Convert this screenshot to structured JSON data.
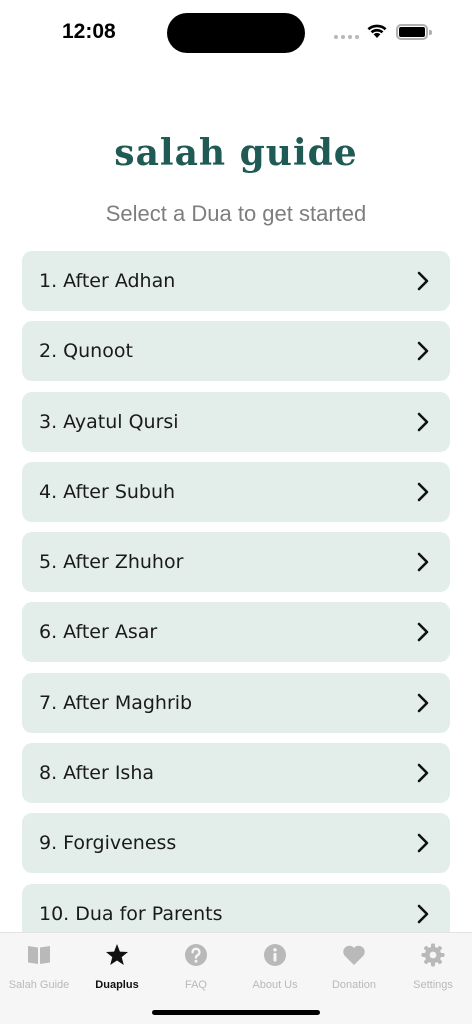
{
  "status_bar": {
    "time": "12:08"
  },
  "header": {
    "logo_text": "salah guide",
    "subtitle": "Select a Dua to get started"
  },
  "duas": [
    {
      "label": "1. After Adhan"
    },
    {
      "label": "2. Qunoot"
    },
    {
      "label": "3. Ayatul Qursi"
    },
    {
      "label": "4. After Subuh"
    },
    {
      "label": "5. After Zhuhor"
    },
    {
      "label": "6. After Asar"
    },
    {
      "label": "7. After Maghrib"
    },
    {
      "label": "8. After Isha"
    },
    {
      "label": "9. Forgiveness"
    },
    {
      "label": "10. Dua for Parents"
    }
  ],
  "tab_bar": {
    "active_tab": "Duaplus",
    "tabs": [
      {
        "label": "Salah Guide",
        "icon": "book-icon"
      },
      {
        "label": "Duaplus",
        "icon": "star-icon"
      },
      {
        "label": "FAQ",
        "icon": "question-icon"
      },
      {
        "label": "About Us",
        "icon": "info-icon"
      },
      {
        "label": "Donation",
        "icon": "heart-icon"
      },
      {
        "label": "Settings",
        "icon": "gear-icon"
      }
    ]
  },
  "colors": {
    "brand": "#1f5a54",
    "item_background": "#e3eeea",
    "subtitle": "#7e7e7e",
    "tab_inactive": "#b9b9b9",
    "tab_active": "#111111"
  }
}
